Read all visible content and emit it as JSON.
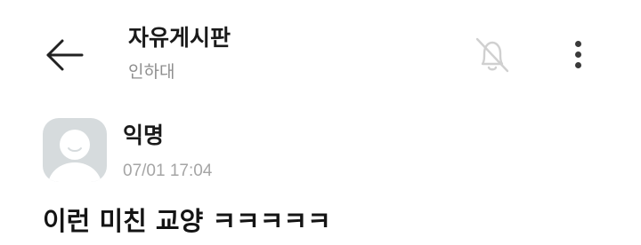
{
  "header": {
    "board_title": "자유게시판",
    "school_name": "인하대",
    "back_icon": "arrow-left-icon",
    "notification_icon": "bell-off-icon",
    "more_icon": "more-vertical-icon"
  },
  "post": {
    "author": "익명",
    "timestamp": "07/01 17:04",
    "title": "이런 미친 교양 ㅋㅋㅋㅋㅋ",
    "avatar_icon": "anonymous-avatar-icon"
  },
  "colors": {
    "background": "#ffffff",
    "avatar_bg": "#d6dbdd",
    "muted_text": "#8e8e8e",
    "timestamp_text": "#a5a5a5",
    "icon_dark": "#3a3a3a",
    "icon_light": "#d0d0d0"
  }
}
